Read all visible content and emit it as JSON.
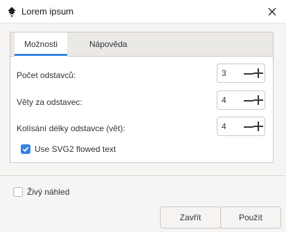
{
  "window": {
    "title": "Lorem ipsum",
    "app_icon": "inkscape-icon",
    "close_icon": "close-icon"
  },
  "tabs": [
    {
      "label": "Možnosti",
      "active": true
    },
    {
      "label": "Nápověda",
      "active": false
    }
  ],
  "fields": [
    {
      "label": "Počet odstavců:",
      "value": "3"
    },
    {
      "label": "Věty za odstavec:",
      "value": "4"
    },
    {
      "label": "Kolísání délky odstavce (vět):",
      "value": "4"
    }
  ],
  "options": {
    "svg2_label": "Use SVG2 flowed text",
    "svg2_checked": true
  },
  "footer": {
    "live_preview_label": "Živý náhled",
    "live_preview_checked": false,
    "close_label": "Zavřít",
    "apply_label": "Použít"
  },
  "colors": {
    "accent": "#3584e4"
  }
}
